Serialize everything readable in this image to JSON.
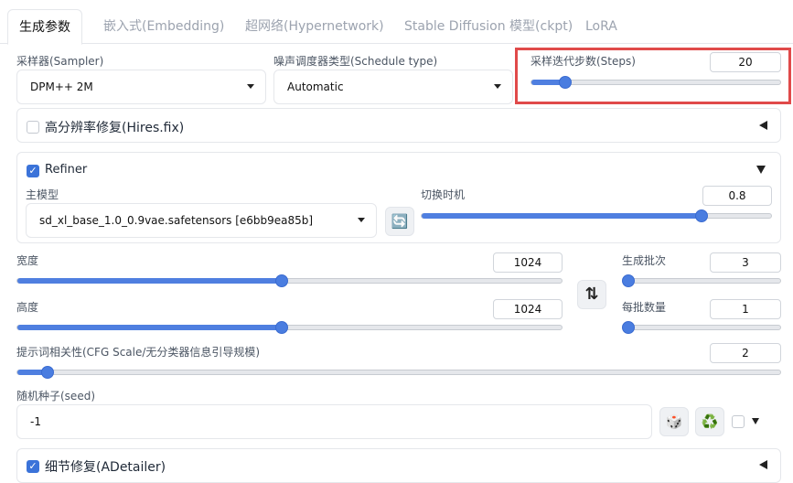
{
  "tabs": [
    "生成参数",
    "嵌入式(Embedding)",
    "超网络(Hypernetwork)",
    "Stable Diffusion 模型(ckpt)",
    "LoRA"
  ],
  "sampler": {
    "label": "采样器(Sampler)",
    "value": "DPM++ 2M"
  },
  "schedule": {
    "label": "噪声调度器类型(Schedule type)",
    "value": "Automatic"
  },
  "steps": {
    "label": "采样迭代步数(Steps)",
    "value": "20",
    "fraction": 0.135
  },
  "hires": {
    "label": "高分辨率修复(Hires.fix)",
    "checked": false
  },
  "refiner": {
    "label": "Refiner",
    "checked": true,
    "model_label": "主模型",
    "model_value": "sd_xl_base_1.0_0.9vae.safetensors [e6bb9ea85b]",
    "switch_label": "切换时机",
    "switch_value": "0.8",
    "switch_fraction": 0.8
  },
  "width": {
    "label": "宽度",
    "value": "1024",
    "fraction": 0.485
  },
  "height": {
    "label": "高度",
    "value": "1024",
    "fraction": 0.485
  },
  "batch_count": {
    "label": "生成批次",
    "value": "3",
    "fraction": 0.0
  },
  "batch_size": {
    "label": "每批数量",
    "value": "1",
    "fraction": 0.0
  },
  "cfg": {
    "label": "提示词相关性(CFG Scale/无分类器信息引导规模)",
    "value": "2",
    "fraction": 0.04
  },
  "seed": {
    "label": "随机种子(seed)",
    "value": "-1"
  },
  "adetailer": {
    "label": "细节修复(ADetailer)",
    "checked": true
  },
  "icons": {
    "refresh": "🔄",
    "swap": "⇅",
    "dice": "🎲",
    "recycle": "♻️"
  },
  "colors": {
    "accent": "#4a7de0",
    "highlight_box": "#e04a4a"
  }
}
